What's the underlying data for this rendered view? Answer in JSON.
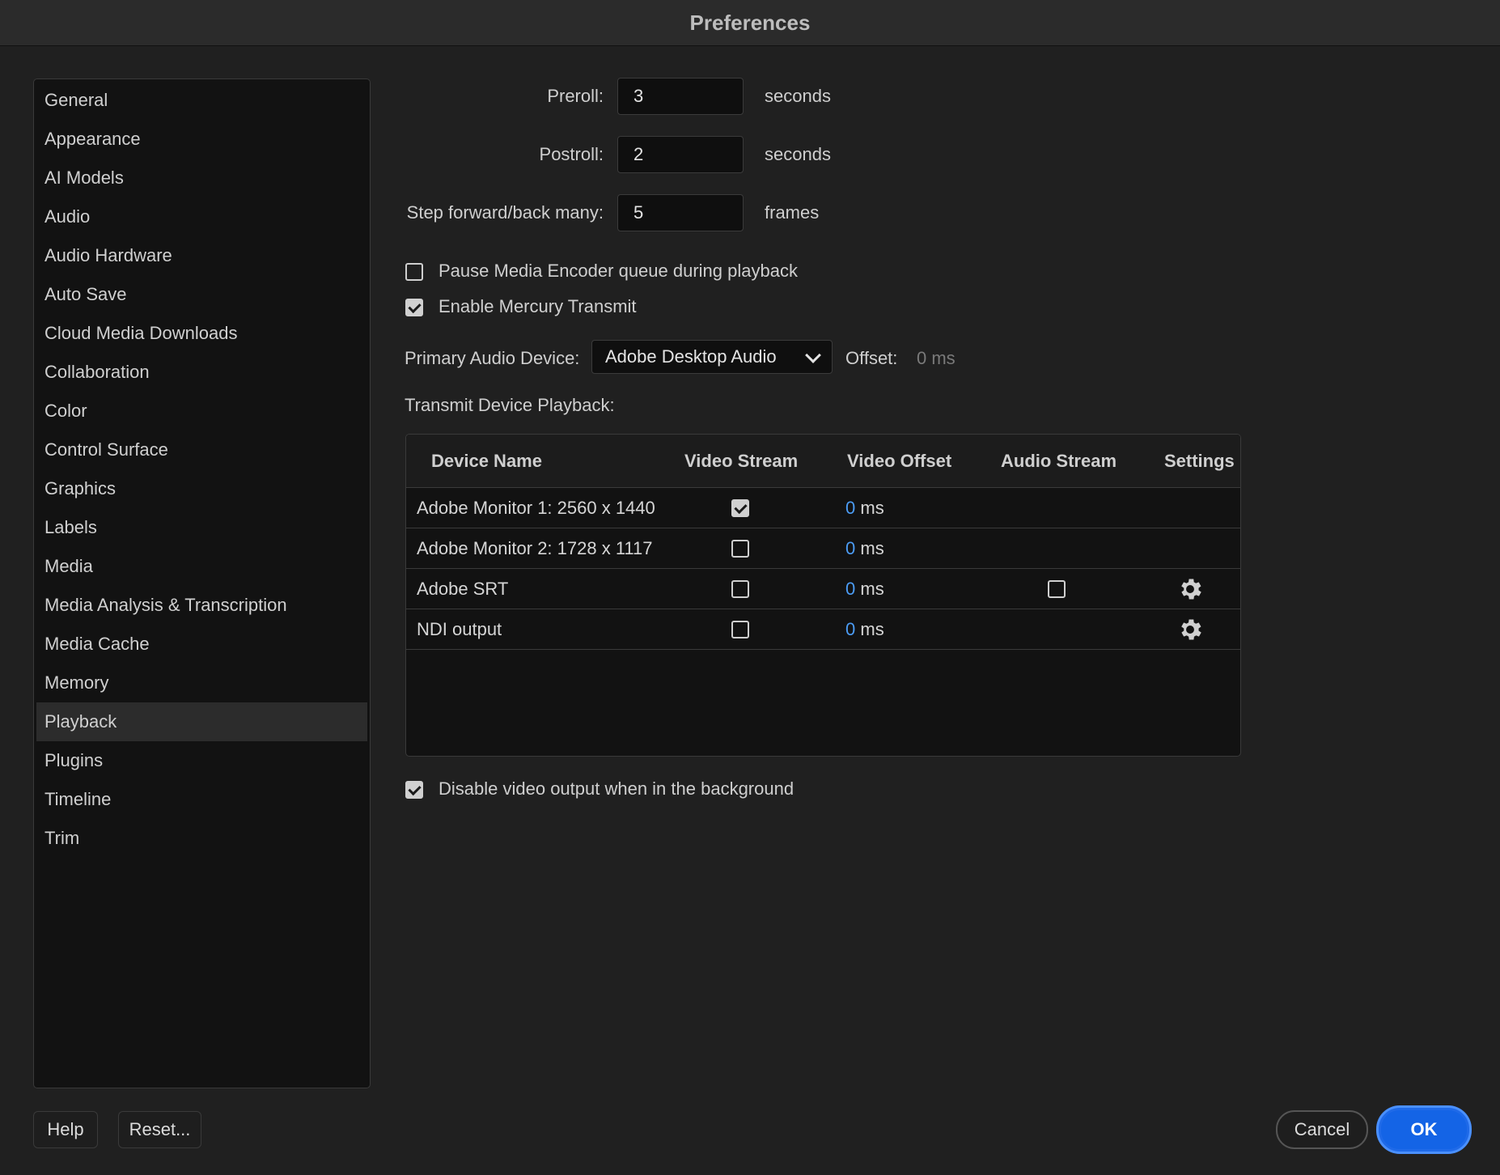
{
  "window": {
    "title": "Preferences"
  },
  "sidebar": {
    "items": [
      {
        "label": "General"
      },
      {
        "label": "Appearance"
      },
      {
        "label": "AI Models"
      },
      {
        "label": "Audio"
      },
      {
        "label": "Audio Hardware"
      },
      {
        "label": "Auto Save"
      },
      {
        "label": "Cloud Media Downloads"
      },
      {
        "label": "Collaboration"
      },
      {
        "label": "Color"
      },
      {
        "label": "Control Surface"
      },
      {
        "label": "Graphics"
      },
      {
        "label": "Labels"
      },
      {
        "label": "Media"
      },
      {
        "label": "Media Analysis & Transcription"
      },
      {
        "label": "Media Cache"
      },
      {
        "label": "Memory"
      },
      {
        "label": "Playback"
      },
      {
        "label": "Plugins"
      },
      {
        "label": "Timeline"
      },
      {
        "label": "Trim"
      }
    ],
    "selected": "Playback"
  },
  "playback": {
    "preroll": {
      "label": "Preroll:",
      "value": "3",
      "unit": "seconds"
    },
    "postroll": {
      "label": "Postroll:",
      "value": "2",
      "unit": "seconds"
    },
    "step": {
      "label": "Step forward/back many:",
      "value": "5",
      "unit": "frames"
    },
    "pause_encoder": {
      "label": "Pause Media Encoder queue during playback",
      "checked": false
    },
    "mercury": {
      "label": "Enable Mercury Transmit",
      "checked": true
    },
    "audio_device": {
      "label": "Primary Audio Device:",
      "value": "Adobe Desktop Audio"
    },
    "offset": {
      "label": "Offset:",
      "value": "0 ms"
    },
    "transmit_label": "Transmit Device Playback:",
    "disable_bg": {
      "label": "Disable video output when in the background",
      "checked": true
    }
  },
  "table": {
    "headers": [
      "Device Name",
      "Video Stream",
      "Video Offset",
      "Audio Stream",
      "Settings"
    ],
    "rows": [
      {
        "name": "Adobe Monitor 1: 2560 x 1440",
        "video": true,
        "offset": "0",
        "unit": "ms",
        "audio": null,
        "settings": false
      },
      {
        "name": "Adobe Monitor 2: 1728 x 1117",
        "video": false,
        "offset": "0",
        "unit": "ms",
        "audio": null,
        "settings": false
      },
      {
        "name": "Adobe SRT",
        "video": false,
        "offset": "0",
        "unit": "ms",
        "audio": false,
        "settings": true
      },
      {
        "name": "NDI output",
        "video": false,
        "offset": "0",
        "unit": "ms",
        "audio": null,
        "settings": true
      }
    ]
  },
  "buttons": {
    "help": "Help",
    "reset": "Reset...",
    "cancel": "Cancel",
    "ok": "OK"
  },
  "icons": {
    "gear": "gear-icon",
    "chevron": "chevron-down-icon",
    "checkmark": "checkmark-icon"
  },
  "colors": {
    "accent": "#1464e6",
    "offset_value": "#4b9cf5",
    "background": "#202020"
  }
}
